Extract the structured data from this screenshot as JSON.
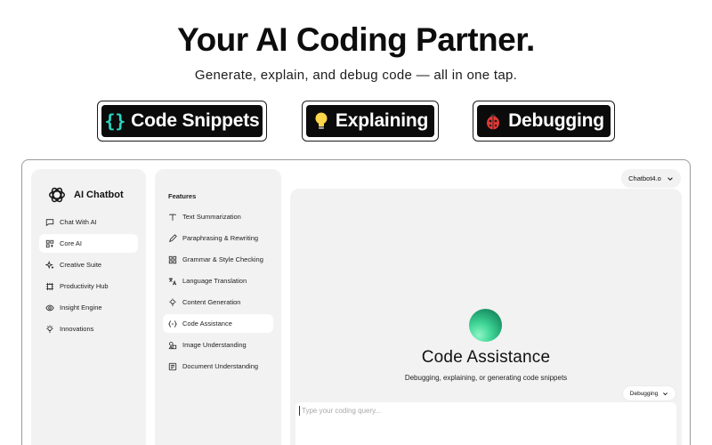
{
  "hero": {
    "title": "Your AI Coding Partner.",
    "subtitle": "Generate, explain, and debug code — all in one tap."
  },
  "pills": [
    {
      "icon": "curly-braces-icon",
      "label": "Code Snippets"
    },
    {
      "icon": "lightbulb-icon",
      "label": "Explaining"
    },
    {
      "icon": "ladybug-icon",
      "label": "Debugging"
    }
  ],
  "sidebar": {
    "brand": "AI Chatbot",
    "items": [
      {
        "label": "Chat With AI",
        "icon": "chat-bubble-icon"
      },
      {
        "label": "Core AI",
        "icon": "core-grid-icon",
        "active": true
      },
      {
        "label": "Creative Suite",
        "icon": "sparkle-icon"
      },
      {
        "label": "Productivity Hub",
        "icon": "hub-icon"
      },
      {
        "label": "Insight Engine",
        "icon": "eye-icon"
      },
      {
        "label": "Innovations",
        "icon": "lightbulb-icon"
      }
    ]
  },
  "features": {
    "title": "Features",
    "items": [
      {
        "label": "Text Summarization",
        "icon": "text-icon"
      },
      {
        "label": "Paraphrasing & Rewriting",
        "icon": "pencil-icon"
      },
      {
        "label": "Grammar & Style Checking",
        "icon": "grid-check-icon"
      },
      {
        "label": "Language Translation",
        "icon": "translate-icon"
      },
      {
        "label": "Content Generation",
        "icon": "lightbulb-icon"
      },
      {
        "label": "Code Assistance",
        "icon": "code-brackets-icon",
        "active": true
      },
      {
        "label": "Image Understanding",
        "icon": "image-shapes-icon"
      },
      {
        "label": "Document Understanding",
        "icon": "document-icon"
      }
    ]
  },
  "model_select": {
    "value": "Chatbot4.o"
  },
  "main": {
    "title": "Code Assistance",
    "subtitle": "Debugging, explaining, or generating code snippets",
    "mode": "Debugging",
    "query_placeholder": "Type your coding query..."
  },
  "colors": {
    "accent_brace": "#2ad6c2",
    "orb_green": "#3fd696",
    "panel_bg": "#f2f2f2"
  }
}
